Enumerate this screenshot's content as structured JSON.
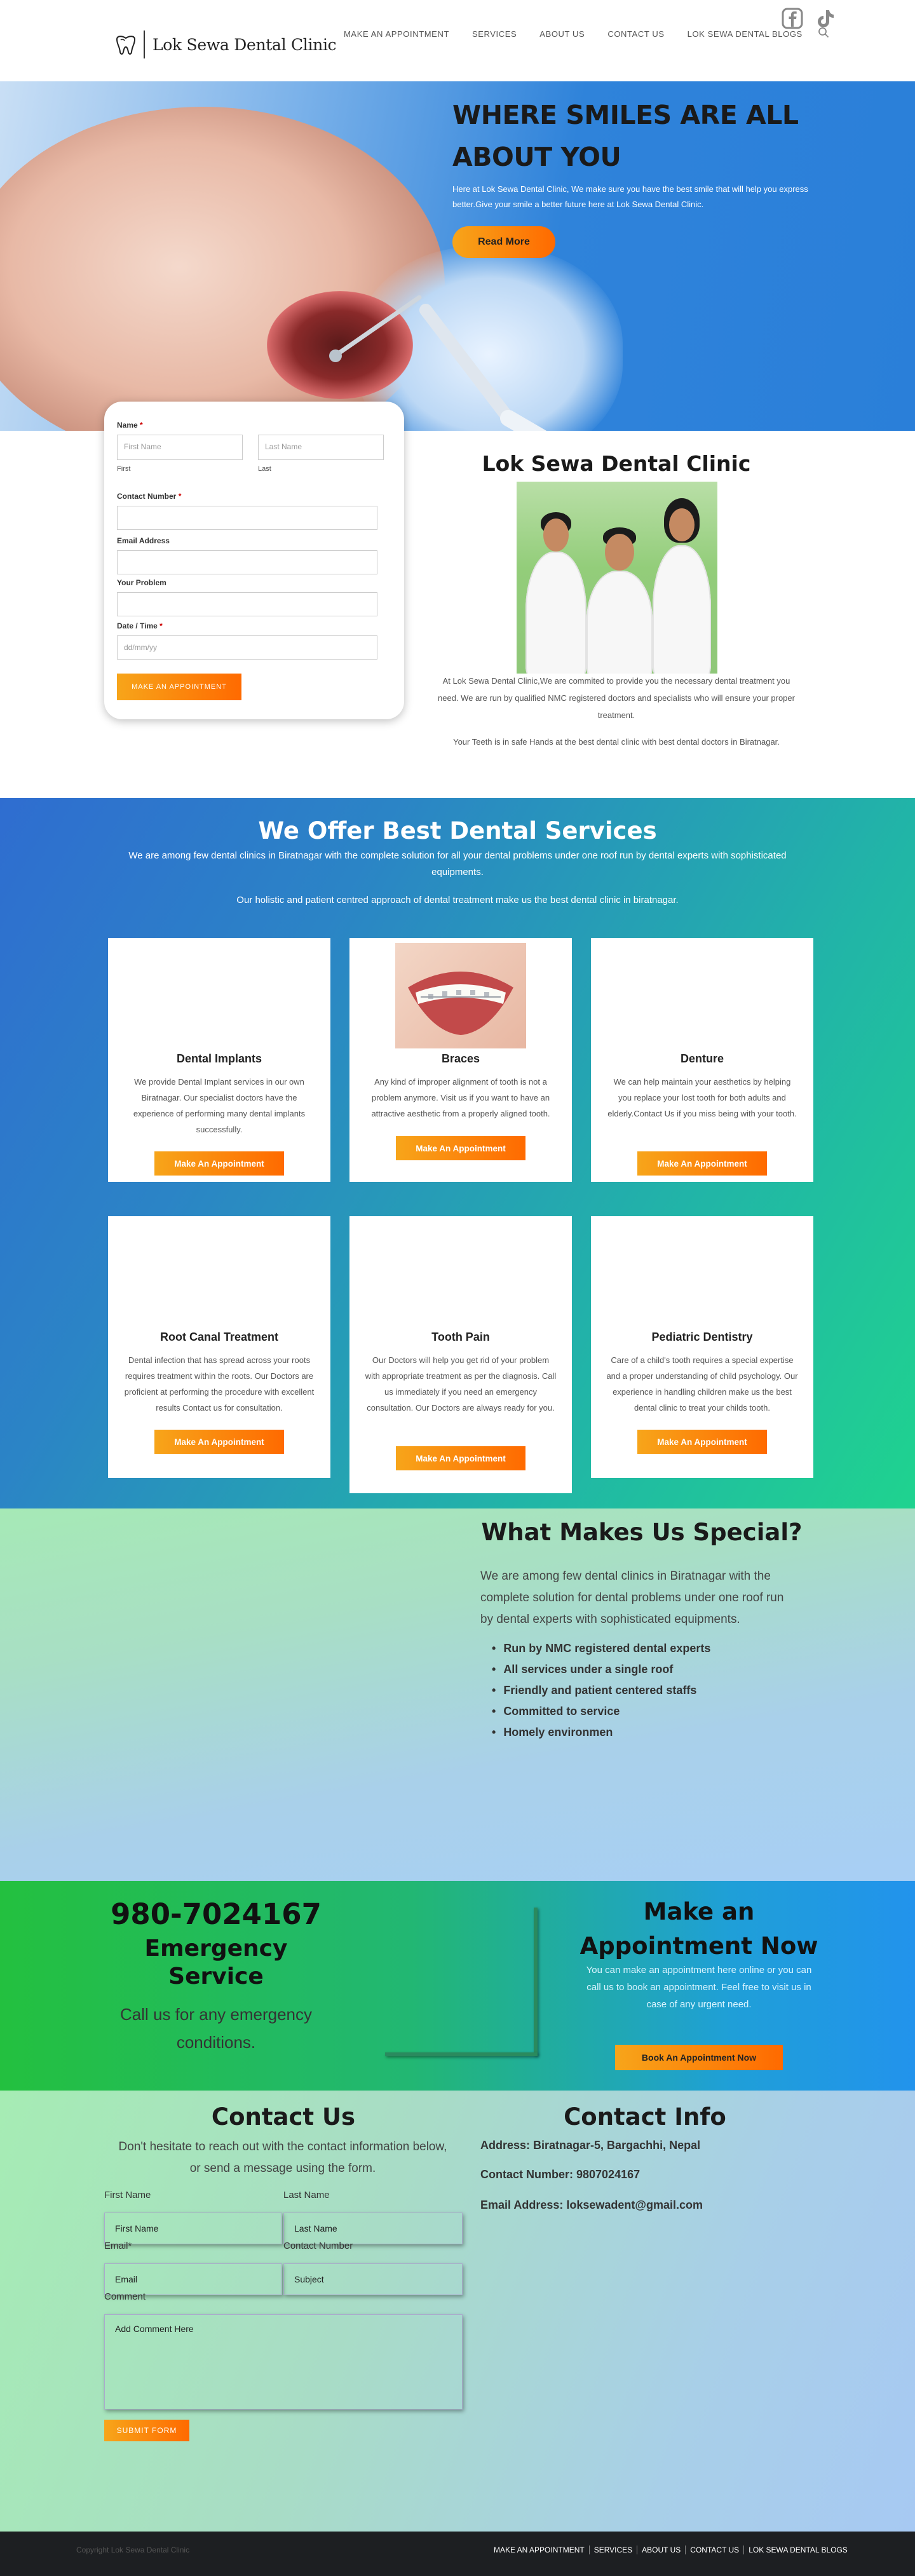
{
  "header": {
    "brand": "Lok Sewa Dental Clinic",
    "nav": [
      "MAKE AN APPOINTMENT",
      "SERVICES",
      "ABOUT US",
      "CONTACT US",
      "LOK SEWA DENTAL BLOGS"
    ],
    "social_icons": [
      "facebook-icon",
      "tiktok-icon"
    ]
  },
  "hero": {
    "title": "WHERE SMILES ARE ALL ABOUT YOU",
    "text": "Here at Lok Sewa Dental Clinic, We make sure you have the best smile that will help you express better.Give your smile a better future here at Lok Sewa Dental Clinic.",
    "button": "Read More"
  },
  "form": {
    "name_label": "Name",
    "first_placeholder": "First Name",
    "last_placeholder": "Last Name",
    "first_sub": "First",
    "last_sub": "Last",
    "contact_label": "Contact Number",
    "email_label": "Email Address",
    "problem_label": "Your Problem",
    "date_label": "Date / Time",
    "date_placeholder": "dd/mm/yy",
    "submit": "MAKE AN APPOINTMENT"
  },
  "clinic": {
    "title": "Lok Sewa Dental Clinic",
    "p1": "At Lok Sewa Dental Clinic,We are commited to provide you the necessary dental treatment you need. We are run by qualified NMC registered doctors and specialists who will ensure your proper treatment.",
    "p2": "Your Teeth is in safe Hands at the best dental clinic with best dental doctors in Biratnagar."
  },
  "services": {
    "title": "We Offer Best Dental Services",
    "sub1": "We are among few dental clinics in Biratnagar with the complete solution for all your dental problems under one roof run by dental experts with sophisticated equipments.",
    "sub2": "Our holistic and patient centred approach of dental treatment make us the best dental clinic in biratnagar.",
    "cards": [
      {
        "title": "Dental Implants",
        "text": "We provide Dental Implant services in our own Biratnagar. Our specialist doctors have the experience of performing many dental implants successfully.",
        "button": "Make An Appointment"
      },
      {
        "title": "Braces",
        "text": "Any kind of improper alignment of tooth is not a problem anymore. Visit us if you want to have an attractive aesthetic from a properly aligned tooth.",
        "button": "Make An Appointment"
      },
      {
        "title": "Denture",
        "text": "We can help maintain your aesthetics by helping you replace your lost tooth for both adults and elderly.Contact Us if you miss being with your tooth.",
        "button": "Make An Appointment"
      },
      {
        "title": "Root Canal Treatment",
        "text": "Dental infection that has spread across your roots requires treatment within the roots. Our Doctors are proficient at performing the procedure with excellent results Contact us for consultation.",
        "button": "Make An Appointment"
      },
      {
        "title": "Tooth Pain",
        "text": "Our Doctors will help you get rid of your problem with appropriate treatment as per the diagnosis. Call us immediately if you need an emergency consultation. Our Doctors are always ready for you.",
        "button": "Make An Appointment"
      },
      {
        "title": "Pediatric Dentistry",
        "text": "Care of a child's tooth requires a special expertise and a proper understanding of child psychology. Our experience in handling children make us the best dental clinic to treat your childs tooth.",
        "button": "Make An Appointment"
      }
    ]
  },
  "special": {
    "title": "What Makes Us Special?",
    "intro": "We are among few dental clinics in Biratnagar with the complete solution for dental problems under one roof run by dental experts with sophisticated equipments.",
    "items": [
      "Run by NMC registered dental experts",
      "All services under a single roof",
      "Friendly and patient centered staffs",
      "Committed to service",
      "Homely environmen"
    ]
  },
  "emergency": {
    "phone": "980-7024167",
    "title": "Emergency Service",
    "sub": "Call us for any emergency conditions."
  },
  "appointment": {
    "title": "Make an Appointment Now",
    "text": "You can make an appointment here online or you can call us to book an appointment. Feel free to visit us in case of any urgent need.",
    "button": "Book An Appointment Now"
  },
  "contact": {
    "title": "Contact Us",
    "sub": "Don't hesitate to reach out with the contact information below, or send a message using the form.",
    "first_label": "First Name",
    "last_label": "Last Name",
    "first_ph": "First Name",
    "last_ph": "Last Name",
    "email_label": "Email*",
    "contact_label": "Contact Number",
    "email_ph": "Email",
    "subject_ph": "Subject",
    "comment_label": "Comment",
    "comment_ph": "Add Comment Here",
    "submit": "SUBMIT FORM"
  },
  "info": {
    "title": "Contact Info",
    "address": "Address: Biratnagar-5, Bargachhi, Nepal",
    "number": "Contact Number: 9807024167",
    "email": "Email Address: loksewadent@gmail.com"
  },
  "footer": {
    "copyright": "Copyright Lok Sewa Dental Clinic",
    "nav": [
      "MAKE AN APPOINTMENT",
      "SERVICES",
      "ABOUT US",
      "CONTACT US",
      "LOK SEWA DENTAL BLOGS"
    ]
  },
  "colors": {
    "accent_start": "#f7a51a",
    "accent_end": "#ff6a00",
    "footer": "#1d1f22"
  }
}
